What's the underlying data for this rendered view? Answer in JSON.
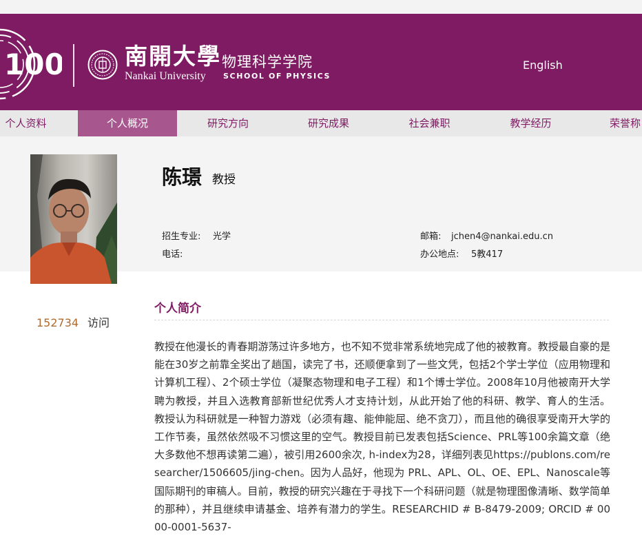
{
  "header": {
    "university_cn": "南開大學",
    "university_en": "Nankai University",
    "school_cn": "物理科学学院",
    "school_en": "SCHOOL OF PHYSICS",
    "anniversary_logo_text": "100",
    "language_link": "English",
    "brand_color": "#7e1b63"
  },
  "nav": {
    "items": [
      "个人资料",
      "个人概况",
      "研究方向",
      "研究成果",
      "社会兼职",
      "教学经历",
      "荣誉称"
    ],
    "active_index": 1
  },
  "profile": {
    "name": "陈璟",
    "title": "教授",
    "major_label": "招生专业:",
    "major_value": "光学",
    "phone_label": "电话:",
    "phone_value": "",
    "email_label": "邮箱:",
    "email_value": "jchen4@nankai.edu.cn",
    "office_label": "办公地点:",
    "office_value": "5教417"
  },
  "stats": {
    "visit_count": "152734",
    "visit_label": "访问"
  },
  "intro": {
    "heading": "个人简介",
    "text": "教授在他漫长的青春期游荡过许多地方，也不知不觉非常系统地完成了他的被教育。教授最自豪的是能在30岁之前靠全奖出了趟国，读完了书，还顺便拿到了一些文凭，包括2个学士学位（应用物理和计算机工程）、2个硕士学位（凝聚态物理和电子工程）和1个博士学位。2008年10月他被南开大学聘为教授，并且入选教育部新世纪优秀人才支持计划，从此开始了他的科研、教学、育人的生活。 教授认为科研就是一种智力游戏（必须有趣、能伸能屈、绝不贪刀），而且他的确很享受南开大学的工作节奏，虽然依然吸不习惯这里的空气。教授目前已发表包括Science、PRL等100余篇文章（绝大多数他不想再读第二遍），被引用2600余次, h-index为28，详细列表见https://publons.com/researcher/1506605/jing-chen。因为人品好，他现为 PRL、APL、OL、OE、EPL、Nanoscale等国际期刊的审稿人。目前，教授的研究兴趣在于寻找下一个科研问题（就是物理图像清晰、数学简单的那种），并且继续申请基金、培养有潜力的学生。RESEARCHID # B-8479-2009; ORCID # 0000-0001-5637-"
  }
}
